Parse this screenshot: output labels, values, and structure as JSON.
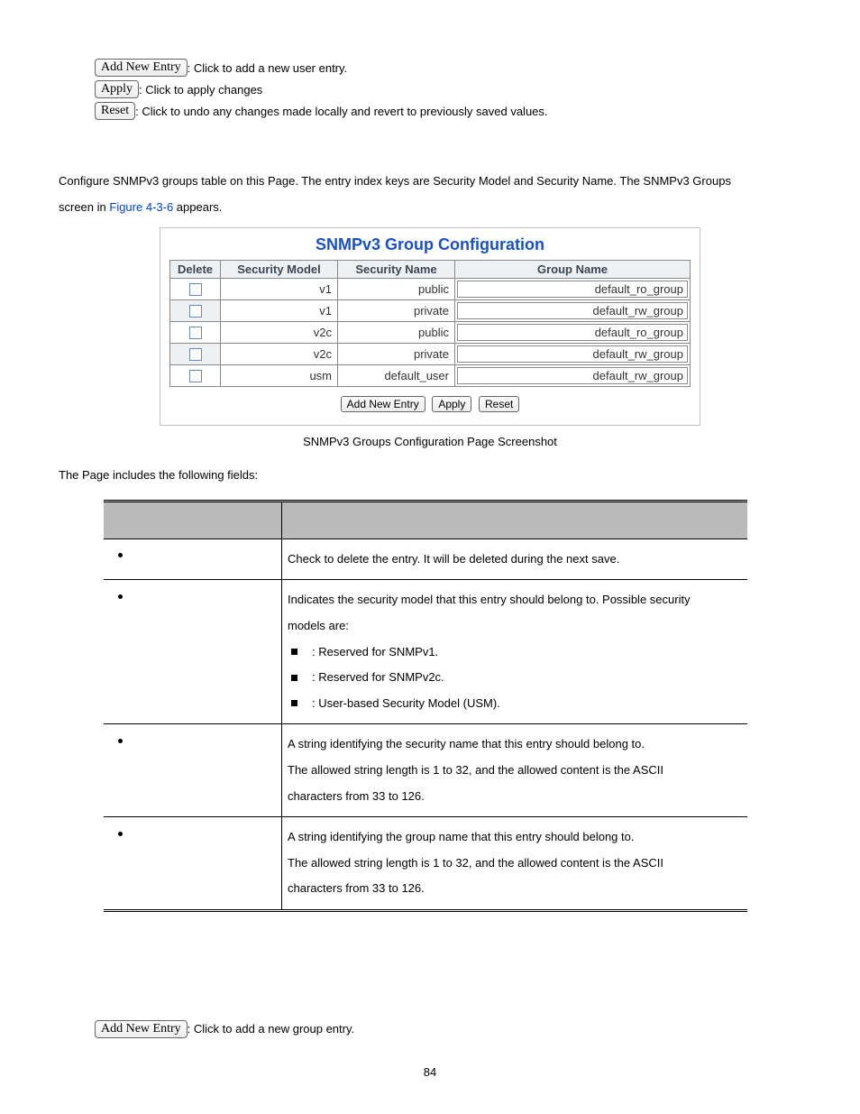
{
  "topButtons": {
    "addNewEntry": {
      "label": "Add New Entry",
      "desc": ": Click to add a new user entry."
    },
    "apply": {
      "label": "Apply",
      "desc": ": Click to apply changes"
    },
    "reset": {
      "label": "Reset",
      "desc": ": Click to undo any changes made locally and revert to previously saved values."
    }
  },
  "intro": {
    "line1a": "Configure SNMPv3 groups table on this Page. The entry index keys are Security Model and Security Name. The SNMPv3 Groups ",
    "line1b": "screen in ",
    "figref": "Figure 4-3-6",
    "line1c": " appears."
  },
  "panel": {
    "title": "SNMPv3 Group Configuration",
    "headers": {
      "delete": "Delete",
      "model": "Security Model",
      "name": "Security Name",
      "group": "Group Name"
    },
    "rows": [
      {
        "model": "v1",
        "name": "public",
        "group": "default_ro_group"
      },
      {
        "model": "v1",
        "name": "private",
        "group": "default_rw_group"
      },
      {
        "model": "v2c",
        "name": "public",
        "group": "default_ro_group"
      },
      {
        "model": "v2c",
        "name": "private",
        "group": "default_rw_group"
      },
      {
        "model": "usm",
        "name": "default_user",
        "group": "default_rw_group"
      }
    ],
    "actions": {
      "add": "Add New Entry",
      "apply": "Apply",
      "reset": "Reset"
    }
  },
  "caption": "SNMPv3 Groups Configuration Page Screenshot",
  "fieldsIntro": "The Page includes the following fields:",
  "fields": [
    {
      "desc_lines": [
        "Check to delete the entry. It will be deleted during the next save."
      ]
    },
    {
      "desc_lines": [
        "Indicates the security model that this entry should belong to. Possible security",
        "models are:"
      ],
      "items": [
        ": Reserved for SNMPv1.",
        ": Reserved for SNMPv2c.",
        ": User-based Security Model (USM)."
      ]
    },
    {
      "desc_lines": [
        "A string identifying the security name that this entry should belong to.",
        "The allowed string length is 1 to 32, and the allowed content is the ASCII",
        "characters from 33 to 126."
      ]
    },
    {
      "desc_lines": [
        "A string identifying the group name that this entry should belong to.",
        "The allowed string length is 1 to 32, and the allowed content is the ASCII",
        "characters from 33 to 126."
      ]
    }
  ],
  "bottomButton": {
    "label": "Add New Entry",
    "desc": ": Click to add a new group entry."
  },
  "pageNumber": "84"
}
